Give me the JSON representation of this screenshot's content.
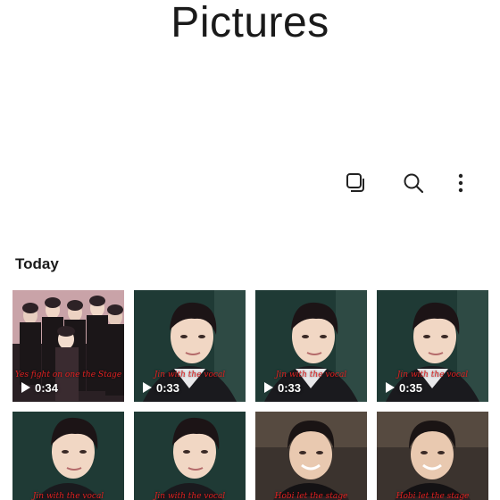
{
  "header": {
    "title": "Pictures"
  },
  "toolbar": {
    "icons": [
      "select-icon",
      "search-icon",
      "more-options-icon"
    ]
  },
  "section": {
    "label": "Today"
  },
  "thumbnails": [
    {
      "caption": "Yes fight on one the Stage",
      "duration": "0:34",
      "type": "video"
    },
    {
      "caption": "Jin with the vocal",
      "duration": "0:33",
      "type": "video"
    },
    {
      "caption": "Jin with the vocal",
      "duration": "0:33",
      "type": "video"
    },
    {
      "caption": "Jin with the vocal",
      "duration": "0:35",
      "type": "video"
    },
    {
      "caption": "Jin with the vocal",
      "duration": "",
      "type": "video"
    },
    {
      "caption": "Jin with the vocal",
      "duration": "",
      "type": "video"
    },
    {
      "caption": "Hobi let the stage",
      "duration": "",
      "type": "video"
    },
    {
      "caption": "Hobi let the stage",
      "duration": "",
      "type": "video"
    }
  ],
  "colors": {
    "caption": "#e02020",
    "background": "#ffffff"
  }
}
